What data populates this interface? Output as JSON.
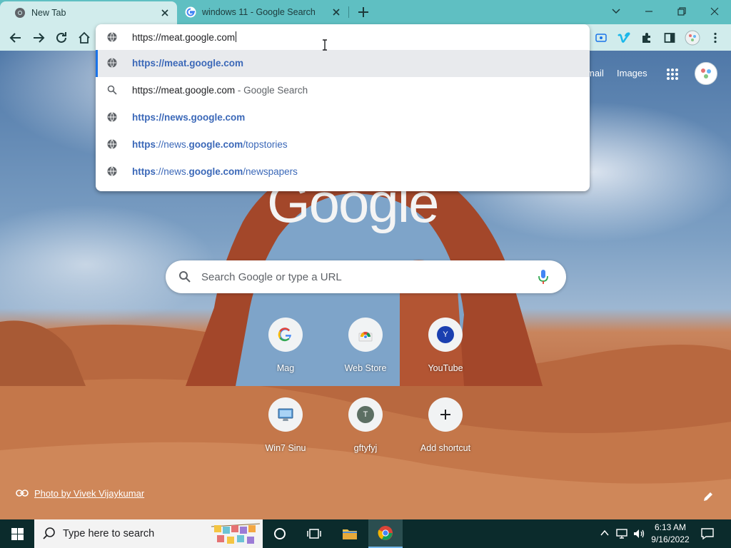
{
  "tabs": [
    {
      "title": "New Tab",
      "active": true
    },
    {
      "title": "windows 11 - Google Search",
      "active": false
    }
  ],
  "omnibox": {
    "value": "https://meat.google.com",
    "suggestions": [
      {
        "prefix": "",
        "bold": "https://meat.google.com",
        "suffix": "",
        "icon": "globe-icon"
      },
      {
        "url": "https://meat.google.com",
        "desc": "- Google Search",
        "icon": "search-icon"
      },
      {
        "prefix": "https",
        "mid": "://news.",
        "bold": "google.com",
        "suffix": "",
        "icon": "globe-icon"
      },
      {
        "prefix": "https",
        "mid": "://news.",
        "bold": "google.com",
        "suffix": "/topstories",
        "icon": "globe-icon"
      },
      {
        "prefix": "https",
        "mid": "://news.",
        "bold": "google.com",
        "suffix": "/newspapers",
        "icon": "globe-icon"
      }
    ]
  },
  "ntp": {
    "links": {
      "gmail": "mail",
      "images": "Images"
    },
    "logo": "Google",
    "search_placeholder": "Search Google or type a URL",
    "shortcuts": [
      {
        "label": "Mag",
        "icon": "google-g-icon"
      },
      {
        "label": "Web Store",
        "icon": "web-store-icon"
      },
      {
        "label": "YouTube",
        "icon": "letter-avatar-icon",
        "letter": "Y"
      },
      {
        "label": "Win7 Sinu",
        "icon": "win7-icon"
      },
      {
        "label": "gftyfyj",
        "icon": "letter-avatar-icon",
        "letter": "T"
      },
      {
        "label": "Add shortcut",
        "icon": "plus-icon"
      }
    ],
    "credit": "Photo by Vivek Vijaykumar"
  },
  "taskbar": {
    "search_text": "Type here to search",
    "time": "6:13 AM",
    "date": "9/16/2022"
  },
  "colors": {
    "tabstrip": "#5fbfc2",
    "toolbar": "#d1ecec",
    "link_blue": "#3b68b8",
    "taskbar": "#0b2b2c"
  }
}
